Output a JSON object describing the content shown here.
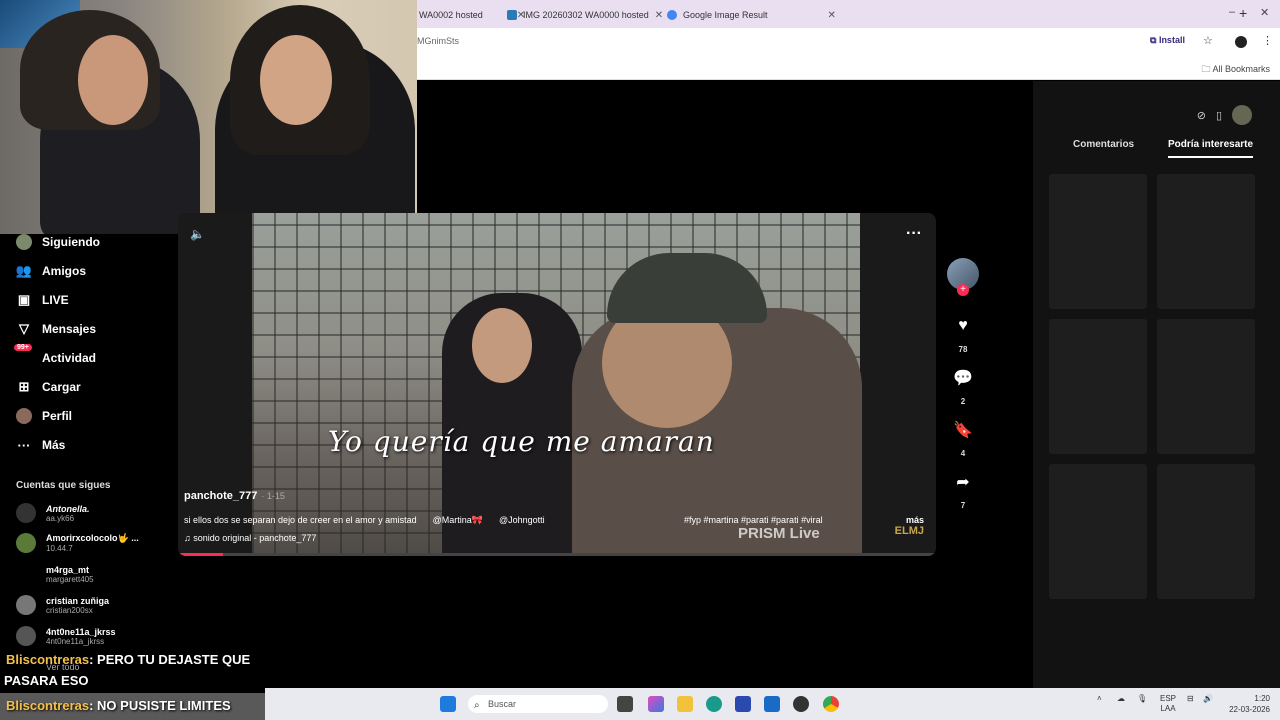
{
  "browser": {
    "tabs": [
      {
        "label": "WA0002 hosted",
        "color": "#2a7ab8"
      },
      {
        "label": "IMG 20260302 WA0000 hosted",
        "color": "#2a7ab8"
      },
      {
        "label": "Google Image Result",
        "color": "#4285f4"
      }
    ],
    "new_tab": "+",
    "url_fragment": "MGnimSts",
    "install_label": "Install",
    "all_bookmarks": "All Bookmarks",
    "win_min": "–",
    "win_max": "❐",
    "win_close": "✕"
  },
  "sidebar": {
    "items": [
      {
        "label": "Siguiendo",
        "icon": "following-avatar-icon"
      },
      {
        "label": "Amigos",
        "icon": "friends-icon"
      },
      {
        "label": "LIVE",
        "icon": "live-icon"
      },
      {
        "label": "Mensajes",
        "icon": "messages-icon"
      },
      {
        "label": "Actividad",
        "icon": "activity-icon",
        "badge": "99+"
      },
      {
        "label": "Cargar",
        "icon": "upload-icon"
      },
      {
        "label": "Perfil",
        "icon": "profile-icon"
      },
      {
        "label": "Más",
        "icon": "more-icon"
      }
    ],
    "following_title": "Cuentas que sigues",
    "following": [
      {
        "name": "Antonella.",
        "handle": "aa.yk66"
      },
      {
        "name": "Amorirxcolocolo🤟 ...",
        "handle": "10.44.7"
      },
      {
        "name": "m4rga_mt",
        "handle": "margarett405"
      },
      {
        "name": "cristian zuñiga",
        "handle": "cristian200sx"
      },
      {
        "name": "4nt0ne11a_jkrss",
        "handle": "4nt0ne11a_jkrss"
      }
    ],
    "see_all": "Ver todo"
  },
  "video": {
    "overlay_text": "Yo quería que me amaran",
    "author": "panchote_777",
    "time": "· 1-15",
    "description": "si ellos dos se separan dejo de creer en el amor y amistad",
    "mentions": [
      "@Martina🎀",
      "@Johngotti"
    ],
    "tags": "#fyp #martina #parati #parati #viral",
    "more": "más",
    "sound": "♫  sonido original - panchote_777",
    "watermark": "PRISM Live",
    "corner_logo": "ELMJ",
    "progress": 0.06
  },
  "actions": {
    "likes": "78",
    "comments": "2",
    "saves": "4",
    "shares": "7"
  },
  "right_panel": {
    "tabs": [
      "Comentarios",
      "Podría interesarte"
    ],
    "active_tab": 1
  },
  "chat": [
    {
      "user": "Bliscontreras",
      "text": ": PERO TU DEJASTE QUE",
      "cont": "PASARA ESO"
    },
    {
      "user": "Bliscontreras",
      "text": ": NO PUSISTE LIMITES"
    }
  ],
  "taskbar": {
    "search_placeholder": "Buscar",
    "lang": "ESP",
    "lang2": "LAA",
    "time": "1:20",
    "date": "22-03-2026"
  }
}
